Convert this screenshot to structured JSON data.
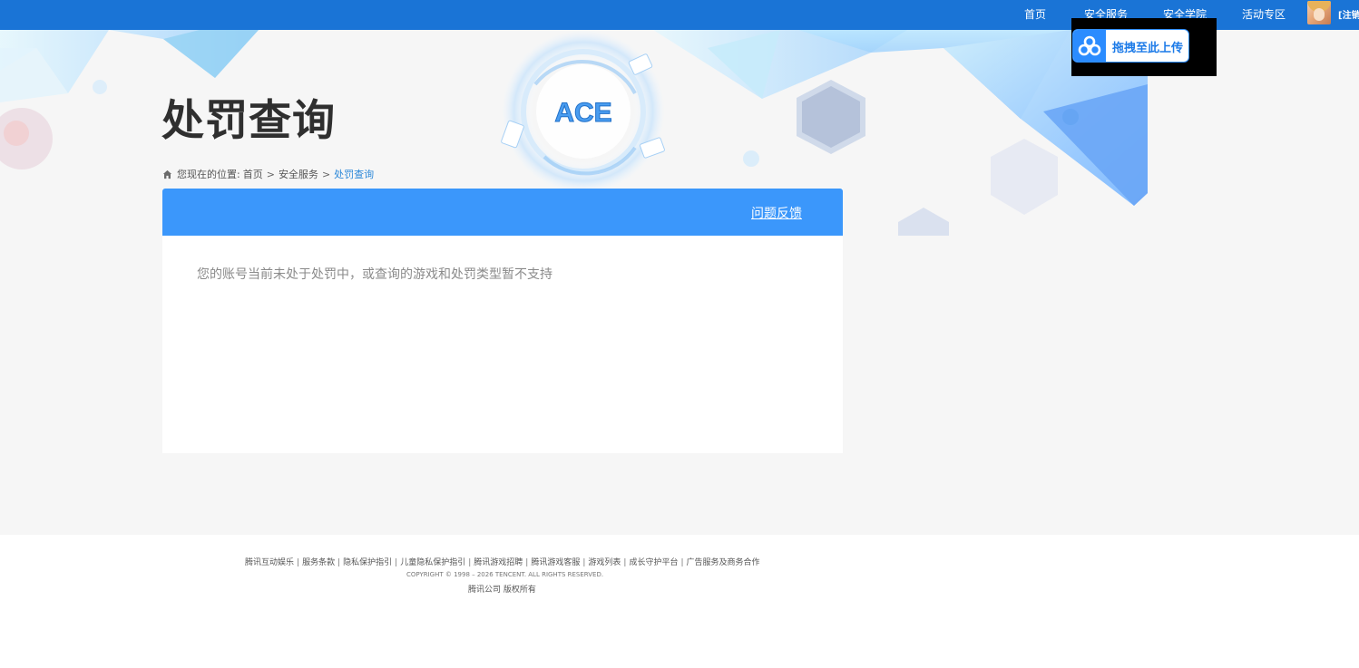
{
  "nav": {
    "items": [
      "首页",
      "安全服务",
      "安全学院",
      "活动专区"
    ],
    "logout_label": "[注销]"
  },
  "page": {
    "title": "处罚查询"
  },
  "breadcrumb": {
    "prefix": "您现在的位置:",
    "items": [
      "首页",
      "安全服务",
      "处罚查询"
    ]
  },
  "card": {
    "feedback_label": "问题反馈",
    "message": "您的账号当前未处于处罚中，或查询的游戏和处罚类型暂不支持"
  },
  "upload": {
    "label": "拖拽至此上传"
  },
  "footer": {
    "links": [
      "腾讯互动娱乐",
      "服务条款",
      "隐私保护指引",
      "儿童隐私保护指引",
      "腾讯游戏招聘",
      "腾讯游戏客服",
      "游戏列表",
      "成长守护平台",
      "广告服务及商务合作"
    ],
    "copyright": "COPYRIGHT © 1998 – 2026 TENCENT. ALL RIGHTS RESERVED.",
    "company": "腾讯公司 版权所有"
  },
  "colors": {
    "topbar": "#1a74d6",
    "card_header": "#3b97fb",
    "breadcrumb_current": "#2a87d8",
    "page_bg": "#f6f6f6"
  },
  "icons": [
    "home-icon",
    "cloud-upload-icon",
    "ace-logo",
    "user-avatar"
  ]
}
